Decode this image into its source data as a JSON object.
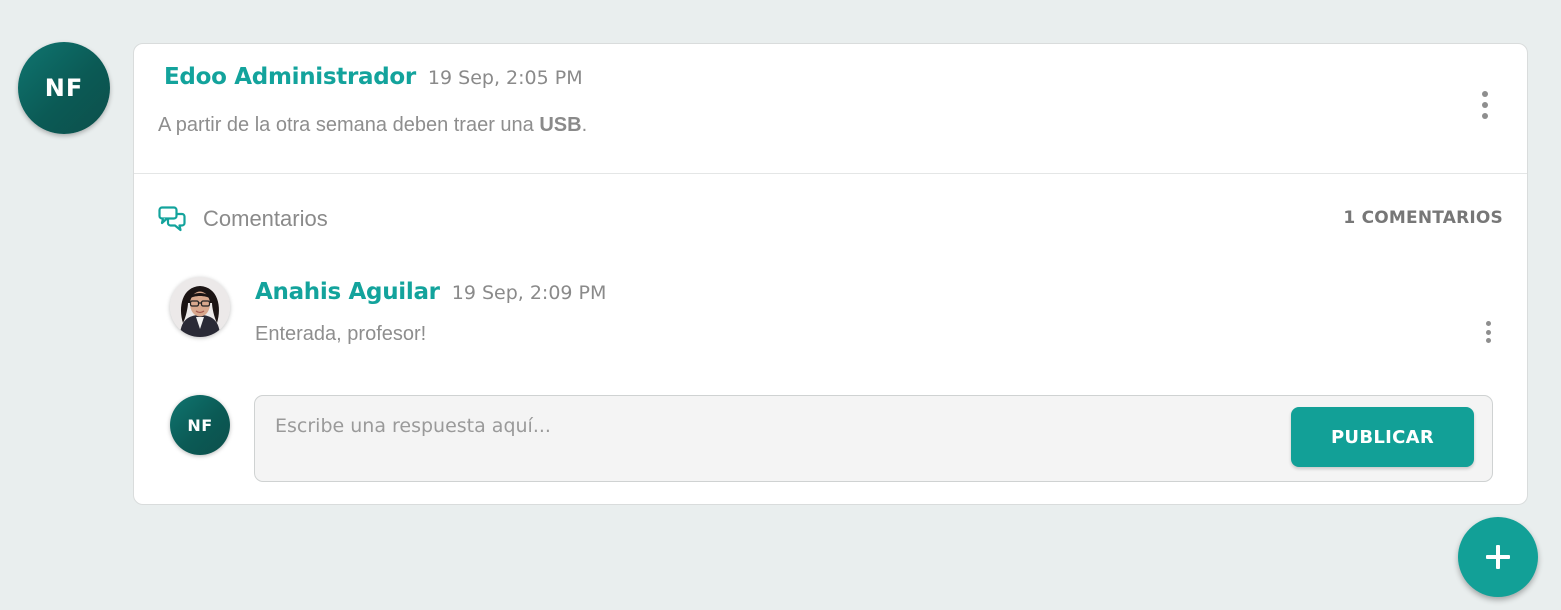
{
  "post": {
    "avatar_initials": "NF",
    "author": "Edoo Administrador",
    "time": "19 Sep, 2:05 PM",
    "body_prefix": "A partir de la otra semana deben traer una ",
    "body_bold": "USB",
    "body_suffix": ".",
    "menu_icon": "more-vertical-icon"
  },
  "comments": {
    "label": "Comentarios",
    "count_label": "1 COMENTARIOS",
    "icon": "chat-bubbles-icon",
    "items": [
      {
        "author": "Anahis Aguilar",
        "time": "19 Sep, 2:09 PM",
        "text": "Enterada, profesor!",
        "avatar": "user-photo"
      }
    ]
  },
  "reply": {
    "avatar_initials": "NF",
    "placeholder": "Escribe una respuesta aquí...",
    "submit_label": "PUBLICAR"
  },
  "fab": {
    "icon": "plus-icon"
  },
  "colors": {
    "accent": "#12a097",
    "avatar": "#0b5a55",
    "background": "#e9eeee",
    "text_muted": "#8e8e8e"
  }
}
